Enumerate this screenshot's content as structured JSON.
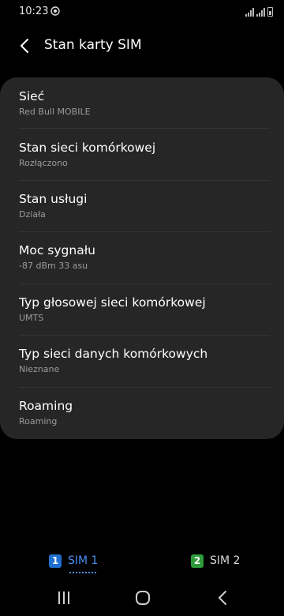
{
  "status_bar": {
    "time": "10:23"
  },
  "header": {
    "title": "Stan karty SIM"
  },
  "items": [
    {
      "title": "Sieć",
      "value": "Red Bull MOBILE"
    },
    {
      "title": "Stan sieci komórkowej",
      "value": "Rozłączono"
    },
    {
      "title": "Stan usługi",
      "value": "Działa"
    },
    {
      "title": "Moc sygnału",
      "value": "-87 dBm 33 asu"
    },
    {
      "title": "Typ głosowej sieci komórkowej",
      "value": "UMTS"
    },
    {
      "title": "Typ sieci danych komórkowych",
      "value": "Nieznane"
    },
    {
      "title": "Roaming",
      "value": "Roaming"
    }
  ],
  "tabs": [
    {
      "badge": "1",
      "label": "SIM 1",
      "selected": true,
      "color": "#1f6fd1",
      "label_color": "#4a8ef0"
    },
    {
      "badge": "2",
      "label": "SIM 2",
      "selected": false,
      "color": "#2e9b3a",
      "label_color": "#d8d8d8"
    }
  ],
  "icons": {
    "back": "back-arrow-icon",
    "recents": "recent-apps-icon",
    "home": "home-icon",
    "nav_back": "nav-back-icon"
  }
}
